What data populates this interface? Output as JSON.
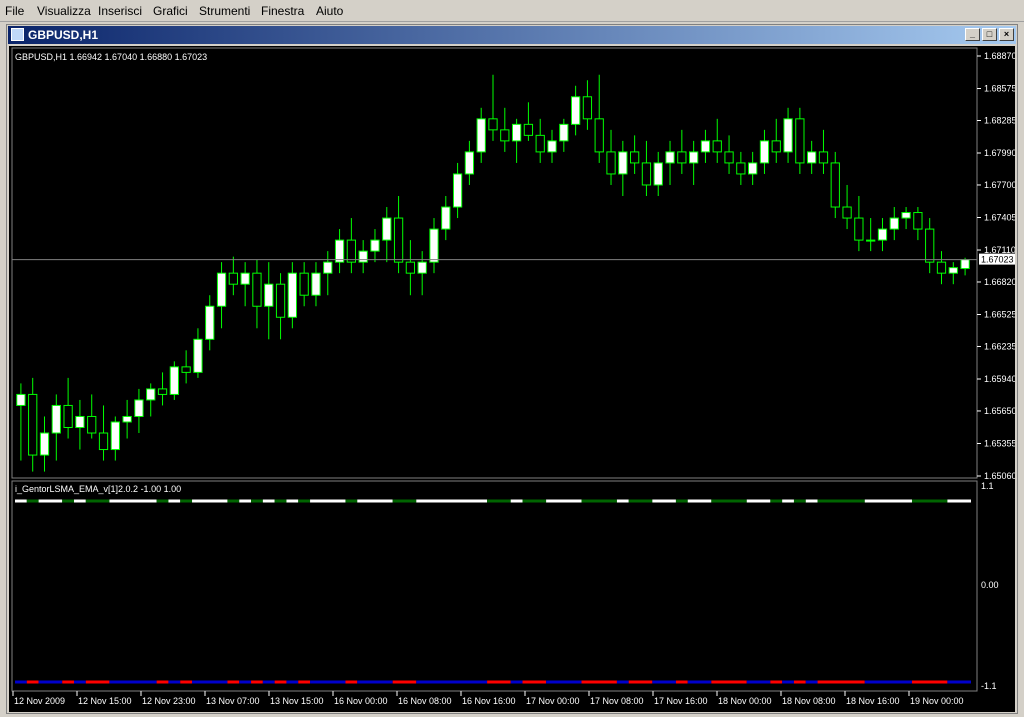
{
  "menu": [
    "File",
    "Visualizza",
    "Inserisci",
    "Grafici",
    "Strumenti",
    "Finestra",
    "Aiuto"
  ],
  "window": {
    "title": "GBPUSD,H1",
    "min_glyph": "_",
    "max_glyph": "□",
    "close_glyph": "×"
  },
  "chart": {
    "info_label": "GBPUSD,H1  1.66942 1.67040 1.66880 1.67023",
    "price_ticks": [
      "1.68870",
      "1.68575",
      "1.68285",
      "1.67990",
      "1.67700",
      "1.67405",
      "1.67110",
      "1.66820",
      "1.66525",
      "1.66235",
      "1.65940",
      "1.65650",
      "1.65355",
      "1.65060"
    ],
    "current_price": "1.67023",
    "indicator_label": "i_GentorLSMA_EMA_v[1]2.0.2 -1.00 1.00",
    "indicator_ticks": [
      "1.1",
      "0.00",
      "-1.1"
    ],
    "time_labels": [
      "12 Nov 2009",
      "12 Nov 15:00",
      "12 Nov 23:00",
      "13 Nov 07:00",
      "13 Nov 15:00",
      "16 Nov 00:00",
      "16 Nov 08:00",
      "16 Nov 16:00",
      "17 Nov 00:00",
      "17 Nov 08:00",
      "17 Nov 16:00",
      "18 Nov 00:00",
      "18 Nov 08:00",
      "18 Nov 16:00",
      "19 Nov 00:00"
    ],
    "colors": {
      "background": "#000000",
      "candle_up": "#ffffff",
      "candle_down": "#000000",
      "wick": "#00ff00",
      "indicator_green": "#006400",
      "indicator_white": "#ffffff",
      "indicator_blue": "#0000cd",
      "indicator_red": "#ff0000"
    }
  },
  "chart_data": {
    "type": "candlestick",
    "symbol": "GBPUSD",
    "timeframe": "H1",
    "ylim": [
      1.6506,
      1.6887
    ],
    "last": {
      "open": 1.66942,
      "high": 1.6704,
      "low": 1.6688,
      "close": 1.67023
    },
    "ohlc": [
      [
        1.657,
        1.659,
        1.652,
        1.658
      ],
      [
        1.658,
        1.6595,
        1.651,
        1.6525
      ],
      [
        1.6525,
        1.656,
        1.651,
        1.6545
      ],
      [
        1.6545,
        1.658,
        1.652,
        1.657
      ],
      [
        1.657,
        1.6595,
        1.654,
        1.655
      ],
      [
        1.655,
        1.6575,
        1.653,
        1.656
      ],
      [
        1.656,
        1.658,
        1.654,
        1.6545
      ],
      [
        1.6545,
        1.657,
        1.652,
        1.653
      ],
      [
        1.653,
        1.656,
        1.652,
        1.6555
      ],
      [
        1.6555,
        1.6575,
        1.654,
        1.656
      ],
      [
        1.656,
        1.6585,
        1.6545,
        1.6575
      ],
      [
        1.6575,
        1.659,
        1.656,
        1.6585
      ],
      [
        1.6585,
        1.66,
        1.657,
        1.658
      ],
      [
        1.658,
        1.661,
        1.6575,
        1.6605
      ],
      [
        1.6605,
        1.662,
        1.659,
        1.66
      ],
      [
        1.66,
        1.664,
        1.6595,
        1.663
      ],
      [
        1.663,
        1.667,
        1.662,
        1.666
      ],
      [
        1.666,
        1.67,
        1.664,
        1.669
      ],
      [
        1.669,
        1.6705,
        1.667,
        1.668
      ],
      [
        1.668,
        1.67,
        1.666,
        1.669
      ],
      [
        1.669,
        1.6702,
        1.664,
        1.666
      ],
      [
        1.666,
        1.67,
        1.663,
        1.668
      ],
      [
        1.668,
        1.669,
        1.663,
        1.665
      ],
      [
        1.665,
        1.67,
        1.664,
        1.669
      ],
      [
        1.669,
        1.67,
        1.666,
        1.667
      ],
      [
        1.667,
        1.67,
        1.666,
        1.669
      ],
      [
        1.669,
        1.671,
        1.667,
        1.67
      ],
      [
        1.67,
        1.673,
        1.669,
        1.672
      ],
      [
        1.672,
        1.674,
        1.669,
        1.67
      ],
      [
        1.67,
        1.672,
        1.669,
        1.671
      ],
      [
        1.671,
        1.673,
        1.67,
        1.672
      ],
      [
        1.672,
        1.675,
        1.67,
        1.674
      ],
      [
        1.674,
        1.676,
        1.669,
        1.67
      ],
      [
        1.67,
        1.672,
        1.667,
        1.669
      ],
      [
        1.669,
        1.671,
        1.667,
        1.67
      ],
      [
        1.67,
        1.674,
        1.669,
        1.673
      ],
      [
        1.673,
        1.676,
        1.672,
        1.675
      ],
      [
        1.675,
        1.679,
        1.674,
        1.678
      ],
      [
        1.678,
        1.681,
        1.677,
        1.68
      ],
      [
        1.68,
        1.684,
        1.679,
        1.683
      ],
      [
        1.683,
        1.687,
        1.681,
        1.682
      ],
      [
        1.682,
        1.684,
        1.68,
        1.681
      ],
      [
        1.681,
        1.683,
        1.679,
        1.6825
      ],
      [
        1.6825,
        1.6845,
        1.681,
        1.6815
      ],
      [
        1.6815,
        1.683,
        1.679,
        1.68
      ],
      [
        1.68,
        1.682,
        1.679,
        1.681
      ],
      [
        1.681,
        1.683,
        1.68,
        1.6825
      ],
      [
        1.6825,
        1.686,
        1.6815,
        1.685
      ],
      [
        1.685,
        1.6865,
        1.682,
        1.683
      ],
      [
        1.683,
        1.687,
        1.679,
        1.68
      ],
      [
        1.68,
        1.682,
        1.677,
        1.678
      ],
      [
        1.678,
        1.681,
        1.676,
        1.68
      ],
      [
        1.68,
        1.6815,
        1.678,
        1.679
      ],
      [
        1.679,
        1.681,
        1.676,
        1.677
      ],
      [
        1.677,
        1.68,
        1.676,
        1.679
      ],
      [
        1.679,
        1.681,
        1.677,
        1.68
      ],
      [
        1.68,
        1.682,
        1.678,
        1.679
      ],
      [
        1.679,
        1.681,
        1.677,
        1.68
      ],
      [
        1.68,
        1.682,
        1.679,
        1.681
      ],
      [
        1.681,
        1.683,
        1.679,
        1.68
      ],
      [
        1.68,
        1.6815,
        1.678,
        1.679
      ],
      [
        1.679,
        1.68,
        1.677,
        1.678
      ],
      [
        1.678,
        1.68,
        1.677,
        1.679
      ],
      [
        1.679,
        1.682,
        1.678,
        1.681
      ],
      [
        1.681,
        1.683,
        1.679,
        1.68
      ],
      [
        1.68,
        1.684,
        1.679,
        1.683
      ],
      [
        1.683,
        1.684,
        1.678,
        1.679
      ],
      [
        1.679,
        1.681,
        1.678,
        1.68
      ],
      [
        1.68,
        1.682,
        1.678,
        1.679
      ],
      [
        1.679,
        1.68,
        1.674,
        1.675
      ],
      [
        1.675,
        1.677,
        1.673,
        1.674
      ],
      [
        1.674,
        1.676,
        1.671,
        1.672
      ],
      [
        1.672,
        1.674,
        1.671,
        1.672
      ],
      [
        1.672,
        1.674,
        1.671,
        1.673
      ],
      [
        1.673,
        1.675,
        1.672,
        1.674
      ],
      [
        1.674,
        1.675,
        1.673,
        1.6745
      ],
      [
        1.6745,
        1.675,
        1.672,
        1.673
      ],
      [
        1.673,
        1.674,
        1.669,
        1.67
      ],
      [
        1.67,
        1.671,
        1.668,
        1.669
      ],
      [
        1.669,
        1.67,
        1.668,
        1.6695
      ],
      [
        1.66942,
        1.6704,
        1.6688,
        1.67023
      ]
    ],
    "indicator": {
      "name": "i_GentorLSMA_EMA_v[1]2.0.2",
      "ylim": [
        -1.1,
        1.1
      ]
    }
  }
}
